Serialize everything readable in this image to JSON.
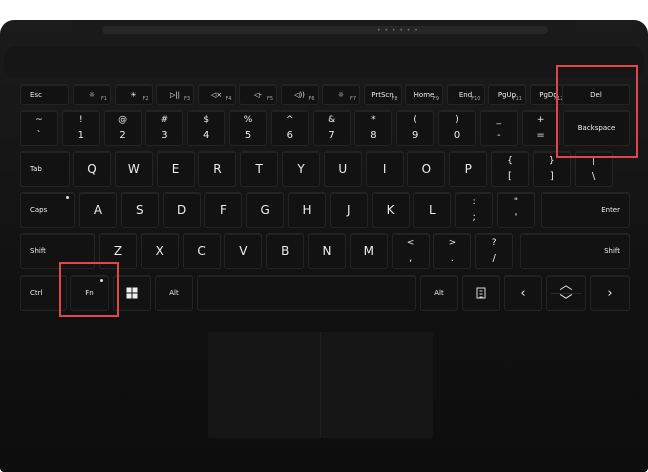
{
  "fn_row": [
    {
      "name": "key-esc",
      "label": "Esc"
    },
    {
      "name": "key-f1",
      "icon": "☼",
      "fn": "F1",
      "icon_name": "brightness-down-icon"
    },
    {
      "name": "key-f2",
      "icon": "☀",
      "fn": "F2",
      "icon_name": "brightness-up-icon"
    },
    {
      "name": "key-f3",
      "icon": "▷||",
      "fn": "F3",
      "icon_name": "play-pause-icon"
    },
    {
      "name": "key-f4",
      "icon": "◁×",
      "fn": "F4",
      "icon_name": "mute-icon"
    },
    {
      "name": "key-f5",
      "icon": "◁-",
      "fn": "F5",
      "icon_name": "volume-down-icon"
    },
    {
      "name": "key-f6",
      "icon": "◁))",
      "fn": "F6",
      "icon_name": "volume-up-icon"
    },
    {
      "name": "key-f7",
      "icon": "☼",
      "fn": "F7",
      "icon_name": "backlight-icon"
    },
    {
      "name": "key-prtscn",
      "label": "PrtScn",
      "fn": "F8"
    },
    {
      "name": "key-home",
      "label": "Home",
      "fn": "F9"
    },
    {
      "name": "key-end",
      "label": "End",
      "fn": "F10"
    },
    {
      "name": "key-pgup",
      "label": "PgUp",
      "fn": "F11"
    },
    {
      "name": "key-pgdn",
      "label": "PgDn",
      "fn": "F12"
    },
    {
      "name": "key-del",
      "label": "Del"
    }
  ],
  "num_row": [
    {
      "name": "key-tilde",
      "up": "~",
      "dn": "`"
    },
    {
      "name": "key-1",
      "up": "!",
      "dn": "1"
    },
    {
      "name": "key-2",
      "up": "@",
      "dn": "2"
    },
    {
      "name": "key-3",
      "up": "#",
      "dn": "3"
    },
    {
      "name": "key-4",
      "up": "$",
      "dn": "4"
    },
    {
      "name": "key-5",
      "up": "%",
      "dn": "5"
    },
    {
      "name": "key-6",
      "up": "^",
      "dn": "6"
    },
    {
      "name": "key-7",
      "up": "&",
      "dn": "7"
    },
    {
      "name": "key-8",
      "up": "*",
      "dn": "8"
    },
    {
      "name": "key-9",
      "up": "(",
      "dn": "9"
    },
    {
      "name": "key-0",
      "up": ")",
      "dn": "0"
    },
    {
      "name": "key-minus",
      "up": "_",
      "dn": "-"
    },
    {
      "name": "key-equals",
      "up": "+",
      "dn": "="
    },
    {
      "name": "key-backspace",
      "label": "Backspace"
    }
  ],
  "q_row": [
    {
      "name": "key-tab",
      "label": "Tab"
    },
    {
      "name": "key-q",
      "label": "Q"
    },
    {
      "name": "key-w",
      "label": "W"
    },
    {
      "name": "key-e",
      "label": "E"
    },
    {
      "name": "key-r",
      "label": "R"
    },
    {
      "name": "key-t",
      "label": "T"
    },
    {
      "name": "key-y",
      "label": "Y"
    },
    {
      "name": "key-u",
      "label": "U"
    },
    {
      "name": "key-i",
      "label": "I"
    },
    {
      "name": "key-o",
      "label": "O"
    },
    {
      "name": "key-p",
      "label": "P"
    },
    {
      "name": "key-lbracket",
      "up": "{",
      "dn": "["
    },
    {
      "name": "key-rbracket",
      "up": "}",
      "dn": "]"
    },
    {
      "name": "key-backslash",
      "up": "|",
      "dn": "\\"
    }
  ],
  "a_row": [
    {
      "name": "key-caps",
      "label": "Caps"
    },
    {
      "name": "key-a",
      "label": "A"
    },
    {
      "name": "key-s",
      "label": "S"
    },
    {
      "name": "key-d",
      "label": "D"
    },
    {
      "name": "key-f",
      "label": "F"
    },
    {
      "name": "key-g",
      "label": "G"
    },
    {
      "name": "key-h",
      "label": "H"
    },
    {
      "name": "key-j",
      "label": "J"
    },
    {
      "name": "key-k",
      "label": "K"
    },
    {
      "name": "key-l",
      "label": "L"
    },
    {
      "name": "key-semicolon",
      "up": ":",
      "dn": ";"
    },
    {
      "name": "key-quote",
      "up": "\"",
      "dn": "'"
    },
    {
      "name": "key-enter",
      "label": "Enter"
    }
  ],
  "z_row": [
    {
      "name": "key-shift-left",
      "label": "Shift"
    },
    {
      "name": "key-z",
      "label": "Z"
    },
    {
      "name": "key-x",
      "label": "X"
    },
    {
      "name": "key-c",
      "label": "C"
    },
    {
      "name": "key-v",
      "label": "V"
    },
    {
      "name": "key-b",
      "label": "B"
    },
    {
      "name": "key-n",
      "label": "N"
    },
    {
      "name": "key-m",
      "label": "M"
    },
    {
      "name": "key-comma",
      "up": "<",
      "dn": ","
    },
    {
      "name": "key-period",
      "up": ">",
      "dn": "."
    },
    {
      "name": "key-slash",
      "up": "?",
      "dn": "/"
    },
    {
      "name": "key-shift-right",
      "label": "Shift"
    }
  ],
  "bottom_row": [
    {
      "name": "key-ctrl",
      "label": "Ctrl"
    },
    {
      "name": "key-fn",
      "label": "Fn"
    },
    {
      "name": "key-windows",
      "icon_name": "windows-logo-icon"
    },
    {
      "name": "key-alt-left",
      "label": "Alt"
    },
    {
      "name": "key-space",
      "label": ""
    },
    {
      "name": "key-alt-right",
      "label": "Alt"
    },
    {
      "name": "key-menu",
      "icon_name": "context-menu-icon"
    },
    {
      "name": "key-left",
      "arrow": "‹",
      "icon_name": "arrow-left-icon"
    },
    {
      "name": "key-up-down",
      "arrow_up": "︿",
      "arrow_down": "﹀",
      "icon_name": "arrow-up-down-icon"
    },
    {
      "name": "key-right",
      "arrow": "›",
      "icon_name": "arrow-right-icon"
    }
  ],
  "colors": {
    "highlight": "#e0474d",
    "keyboard": "#111111",
    "key": "#121212"
  }
}
